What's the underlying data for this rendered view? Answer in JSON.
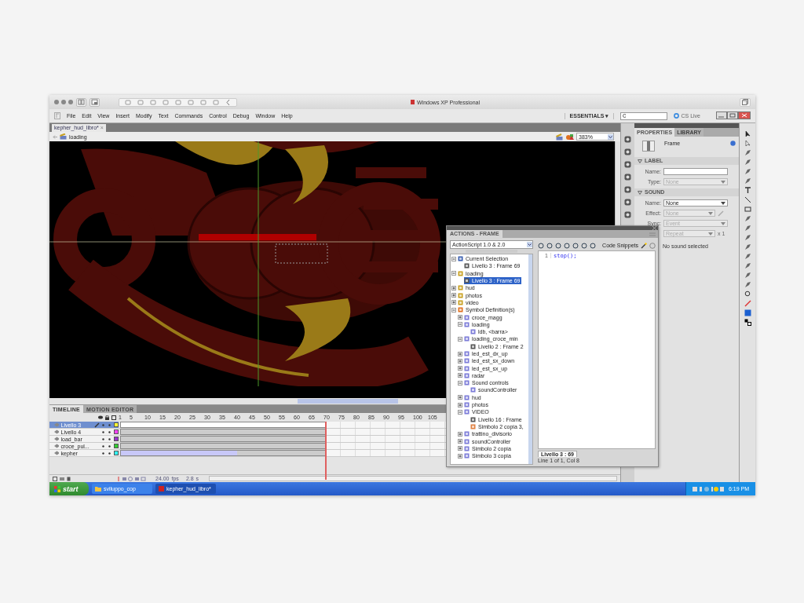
{
  "window": {
    "title": "Windows XP Professional"
  },
  "menu": [
    "File",
    "Edit",
    "View",
    "Insert",
    "Modify",
    "Text",
    "Commands",
    "Control",
    "Debug",
    "Window",
    "Help"
  ],
  "workspace": {
    "label": "ESSENTIALS",
    "caret": "▾",
    "cs_live": "CS Live"
  },
  "document_tab": {
    "title": "kepher_hud_libro*",
    "close": "×"
  },
  "breadcrumb": {
    "scene": "loading",
    "zoom": "383%"
  },
  "timeline": {
    "tabs": [
      {
        "label": "TIMELINE",
        "selected": true
      },
      {
        "label": "MOTION EDITOR",
        "selected": false
      }
    ],
    "frame_numbers": [
      "1",
      "5",
      "10",
      "15",
      "20",
      "25",
      "30",
      "35",
      "40",
      "45",
      "50",
      "55",
      "60",
      "65",
      "70",
      "75",
      "80",
      "85",
      "90",
      "95",
      "100",
      "105"
    ],
    "layers": [
      {
        "name": "Livello 3",
        "selected": true,
        "color": "#ffff33",
        "tween": false,
        "pencil": true
      },
      {
        "name": "Livello 4",
        "selected": false,
        "color": "#ff44ff",
        "tween": false,
        "pencil": false
      },
      {
        "name": "load_bar",
        "selected": false,
        "color": "#9933cc",
        "tween": false,
        "pencil": false
      },
      {
        "name": "croce_pul...",
        "selected": false,
        "color": "#33cc33",
        "tween": false,
        "pencil": false
      },
      {
        "name": "kepher",
        "selected": false,
        "color": "#33ffff",
        "tween": true,
        "pencil": false
      }
    ],
    "fps": "24.00",
    "fps_unit": "fps",
    "time": "2.8",
    "time_unit": "s"
  },
  "properties": {
    "tabs": [
      {
        "label": "PROPERTIES",
        "selected": true
      },
      {
        "label": "LIBRARY",
        "selected": false
      }
    ],
    "object": "Frame",
    "label_section": "LABEL",
    "name_label": "Name:",
    "type_label": "Type:",
    "type_value": "None",
    "sound_section": "SOUND",
    "sound_name_label": "Name:",
    "sound_name_value": "None",
    "effect_label": "Effect:",
    "effect_value": "None",
    "sync_label": "Sync:",
    "sync_value": "Event",
    "repeat_value": "Repeat",
    "repeat_count": "x 1",
    "note": "No sound selected"
  },
  "actions": {
    "title": "ACTIONS - FRAME",
    "language": "ActionScript 1.0 & 2.0",
    "code_snippets": "Code Snippets",
    "tree": [
      {
        "label": "Current Selection",
        "kind": "selection",
        "selected": false,
        "expanded": true,
        "children": [
          {
            "label": "Livello 3 : Frame 69",
            "kind": "frame",
            "selected": false
          }
        ]
      },
      {
        "label": "loading",
        "kind": "scene",
        "selected": false,
        "expanded": true,
        "children": [
          {
            "label": "Livello 3 : Frame 69",
            "kind": "frame",
            "selected": true
          }
        ]
      },
      {
        "label": "hud",
        "kind": "scene",
        "selected": false,
        "expanded": false
      },
      {
        "label": "photos",
        "kind": "scene",
        "selected": false,
        "expanded": false
      },
      {
        "label": "video",
        "kind": "scene",
        "selected": false,
        "expanded": false
      },
      {
        "label": "Symbol Definition(s)",
        "kind": "symbols",
        "selected": false,
        "expanded": true,
        "children": [
          {
            "label": "croce_magg",
            "kind": "symbol",
            "selected": false,
            "expanded": false
          },
          {
            "label": "loading",
            "kind": "symbol",
            "selected": false,
            "expanded": true,
            "children": [
              {
                "label": "ldb, <barra>",
                "kind": "clip",
                "selected": false
              }
            ]
          },
          {
            "label": "loading_croce_min",
            "kind": "symbol",
            "selected": false,
            "expanded": true,
            "children": [
              {
                "label": "Livello 2 : Frame 2",
                "kind": "frame",
                "selected": false
              }
            ]
          },
          {
            "label": "led_est_dx_up",
            "kind": "symbol",
            "selected": false,
            "expanded": false
          },
          {
            "label": "led_est_sx_down",
            "kind": "symbol",
            "selected": false,
            "expanded": false
          },
          {
            "label": "led_est_sx_up",
            "kind": "symbol",
            "selected": false,
            "expanded": false
          },
          {
            "label": "radar",
            "kind": "symbol",
            "selected": false,
            "expanded": false
          },
          {
            "label": "Sound controls",
            "kind": "symbol",
            "selected": false,
            "expanded": true,
            "children": [
              {
                "label": "soundController",
                "kind": "clip",
                "selected": false
              }
            ]
          },
          {
            "label": "hud",
            "kind": "symbol",
            "selected": false,
            "expanded": false
          },
          {
            "label": "photos",
            "kind": "symbol",
            "selected": false,
            "expanded": false
          },
          {
            "label": "VIDEO",
            "kind": "symbol",
            "selected": false,
            "expanded": true,
            "children": [
              {
                "label": "Livello 16 : Frame",
                "kind": "frame",
                "selected": false
              },
              {
                "label": "Simbolo 2 copia 3,",
                "kind": "button",
                "selected": false
              }
            ]
          },
          {
            "label": "trattino_divisorio",
            "kind": "symbol",
            "selected": false,
            "expanded": false
          },
          {
            "label": "soundController",
            "kind": "symbol",
            "selected": false,
            "expanded": false
          },
          {
            "label": "Simbolo 2 copia",
            "kind": "symbol",
            "selected": false,
            "expanded": false
          },
          {
            "label": "Simbolo 3 copia",
            "kind": "symbol",
            "selected": false,
            "expanded": false
          }
        ]
      }
    ],
    "code_lines": [
      {
        "number": "1",
        "text": "stop();"
      }
    ],
    "script_tab": "Livello 3 : 69",
    "status": "Line 1 of 1, Col 8"
  },
  "taskbar": {
    "start": "start",
    "tasks": [
      {
        "label": "sviluppo_cop",
        "kind": "folder",
        "selected": false
      },
      {
        "label": "kepher_hud_libro*",
        "kind": "flash",
        "selected": true
      }
    ],
    "clock": "6:19 PM"
  }
}
